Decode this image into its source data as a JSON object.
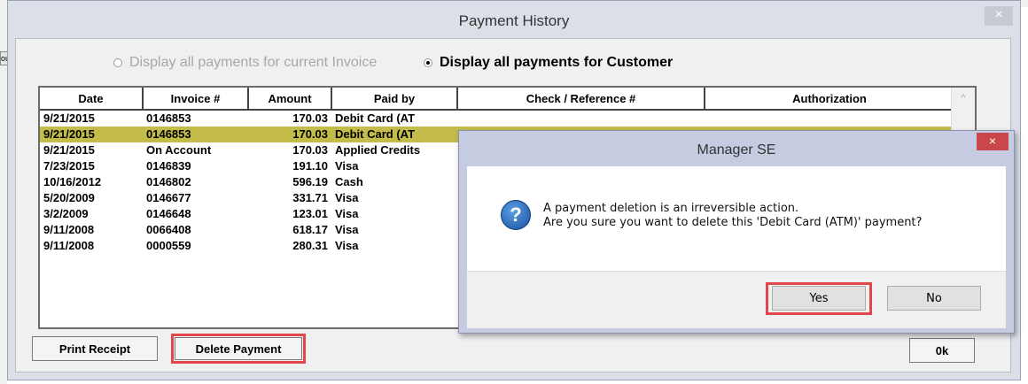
{
  "window": {
    "title": "Payment History",
    "close_glyph": "×"
  },
  "background": {
    "tab_text": "ou"
  },
  "radio_options": [
    {
      "label": "Display all payments for current Invoice",
      "selected": false,
      "enabled": false
    },
    {
      "label": "Display all payments for Customer",
      "selected": true,
      "enabled": true
    }
  ],
  "table": {
    "columns": [
      "Date",
      "Invoice #",
      "Amount",
      "Paid by",
      "Check / Reference #",
      "Authorization"
    ],
    "rows": [
      {
        "date": "9/21/2015",
        "invoice": "0146853",
        "amount": "170.03",
        "paid_by": "Debit Card (AT",
        "reference": "",
        "authorization": "",
        "selected": false
      },
      {
        "date": "9/21/2015",
        "invoice": "0146853",
        "amount": "170.03",
        "paid_by": "Debit Card (AT",
        "reference": "",
        "authorization": "",
        "selected": true
      },
      {
        "date": "9/21/2015",
        "invoice": "On Account",
        "amount": "170.03",
        "paid_by": "Applied Credits",
        "reference": "",
        "authorization": "",
        "selected": false
      },
      {
        "date": "7/23/2015",
        "invoice": "0146839",
        "amount": "191.10",
        "paid_by": "Visa",
        "reference": "",
        "authorization": "",
        "selected": false
      },
      {
        "date": "10/16/2012",
        "invoice": "0146802",
        "amount": "596.19",
        "paid_by": "Cash",
        "reference": "",
        "authorization": "",
        "selected": false
      },
      {
        "date": "5/20/2009",
        "invoice": "0146677",
        "amount": "331.71",
        "paid_by": "Visa",
        "reference": "",
        "authorization": "",
        "selected": false
      },
      {
        "date": "3/2/2009",
        "invoice": "0146648",
        "amount": "123.01",
        "paid_by": "Visa",
        "reference": "",
        "authorization": "",
        "selected": false
      },
      {
        "date": "9/11/2008",
        "invoice": "0066408",
        "amount": "618.17",
        "paid_by": "Visa",
        "reference": "",
        "authorization": "",
        "selected": false
      },
      {
        "date": "9/11/2008",
        "invoice": "0000559",
        "amount": "280.31",
        "paid_by": "Visa",
        "reference": "",
        "authorization": "",
        "selected": false
      }
    ],
    "scroll_up_glyph": "^",
    "selected_row_color": "#c3bc49"
  },
  "buttons": {
    "print_receipt": "Print Receipt",
    "delete_payment": "Delete Payment",
    "ok": "0k"
  },
  "dialog": {
    "title": "Manager SE",
    "close_glyph": "×",
    "icon": "question-icon",
    "icon_glyph": "?",
    "message_line1": "A payment deletion is an irreversible action.",
    "message_line2": "Are you sure you want to delete this 'Debit Card (ATM)' payment?",
    "yes_label": "Yes",
    "no_label": "No"
  },
  "colors": {
    "highlight_border": "#e2474d",
    "dialog_close_bg": "#c9474a"
  }
}
